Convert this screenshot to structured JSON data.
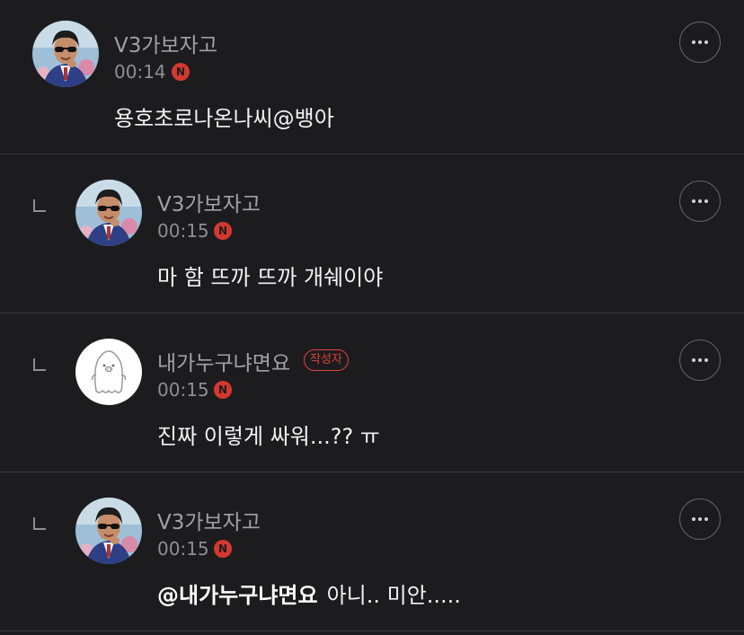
{
  "comments": [
    {
      "nickname": "V3가보자고",
      "time": "00:14",
      "n_badge": "N",
      "text": "용호초로나온나씨@뱅아",
      "is_reply": false,
      "avatar_icon": "profile-photo-man-sunglasses-icon",
      "more_icon": "more-dots-icon"
    },
    {
      "nickname": "V3가보자고",
      "time": "00:15",
      "n_badge": "N",
      "text": "마 함 뜨까 뜨까 개쉐이야",
      "is_reply": true,
      "avatar_icon": "profile-photo-man-sunglasses-icon",
      "more_icon": "more-dots-icon"
    },
    {
      "nickname": "내가누구냐면요",
      "author_badge": "작성자",
      "time": "00:15",
      "n_badge": "N",
      "text": "진짜 이렇게 싸워...?? ㅠ",
      "is_reply": true,
      "avatar_icon": "default-ghost-avatar-icon",
      "more_icon": "more-dots-icon"
    },
    {
      "nickname": "V3가보자고",
      "time": "00:15",
      "n_badge": "N",
      "mention": "@내가누구냐면요",
      "text": "아니.. 미안.....",
      "is_reply": true,
      "avatar_icon": "profile-photo-man-sunglasses-icon",
      "more_icon": "more-dots-icon"
    }
  ],
  "colors": {
    "background": "#1c1c1e",
    "divider": "#3a3a3c",
    "accent_red": "#e0423b",
    "nickname": "#a1a1a6",
    "body_text": "#f2f2f4"
  }
}
